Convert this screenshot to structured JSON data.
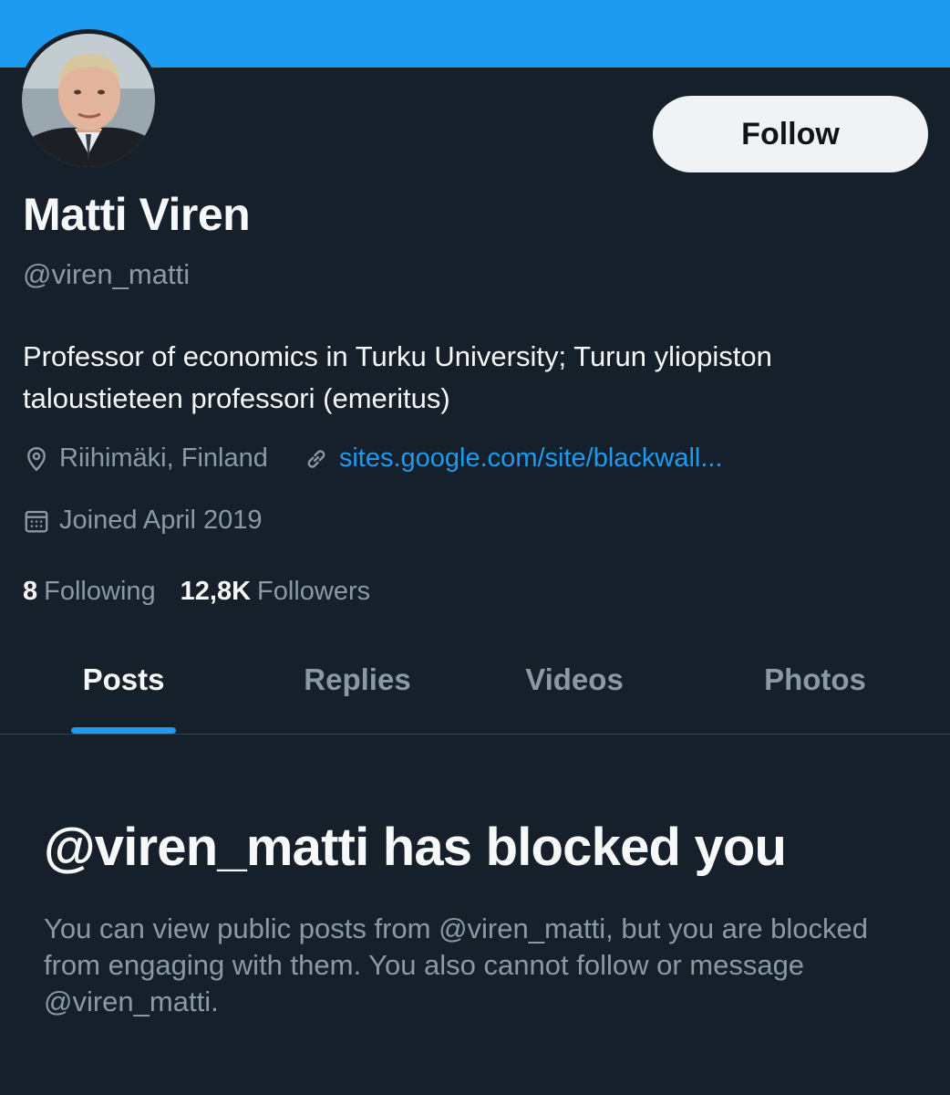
{
  "colors": {
    "background": "#15202b",
    "banner": "#1d9bf0",
    "accent": "#1d9bf0",
    "secondary_text": "#8b98a5",
    "primary_text": "#f7f9f9",
    "button_bg": "#eff3f4"
  },
  "profile": {
    "name": "Matti Viren",
    "handle": "@viren_matti",
    "bio": "Professor of economics in Turku University; Turun yliopiston taloustieteen professori (emeritus)",
    "location": "Riihimäki, Finland",
    "website": "sites.google.com/site/blackwall...",
    "joined": "Joined April 2019",
    "following_count": "8",
    "following_label": "Following",
    "followers_count": "12,8K",
    "followers_label": "Followers",
    "avatar_icon": "profile-photo"
  },
  "actions": {
    "follow_label": "Follow"
  },
  "tabs": [
    {
      "label": "Posts",
      "active": true
    },
    {
      "label": "Replies",
      "active": false
    },
    {
      "label": "Videos",
      "active": false
    },
    {
      "label": "Photos",
      "active": false
    }
  ],
  "blocked": {
    "title": "@viren_matti has blocked you",
    "message": "You can view public posts from @viren_matti, but you are blocked from engaging with them. You also cannot follow or message @viren_matti."
  },
  "icons": {
    "location": "location-pin-icon",
    "link": "link-icon",
    "calendar": "calendar-icon"
  }
}
